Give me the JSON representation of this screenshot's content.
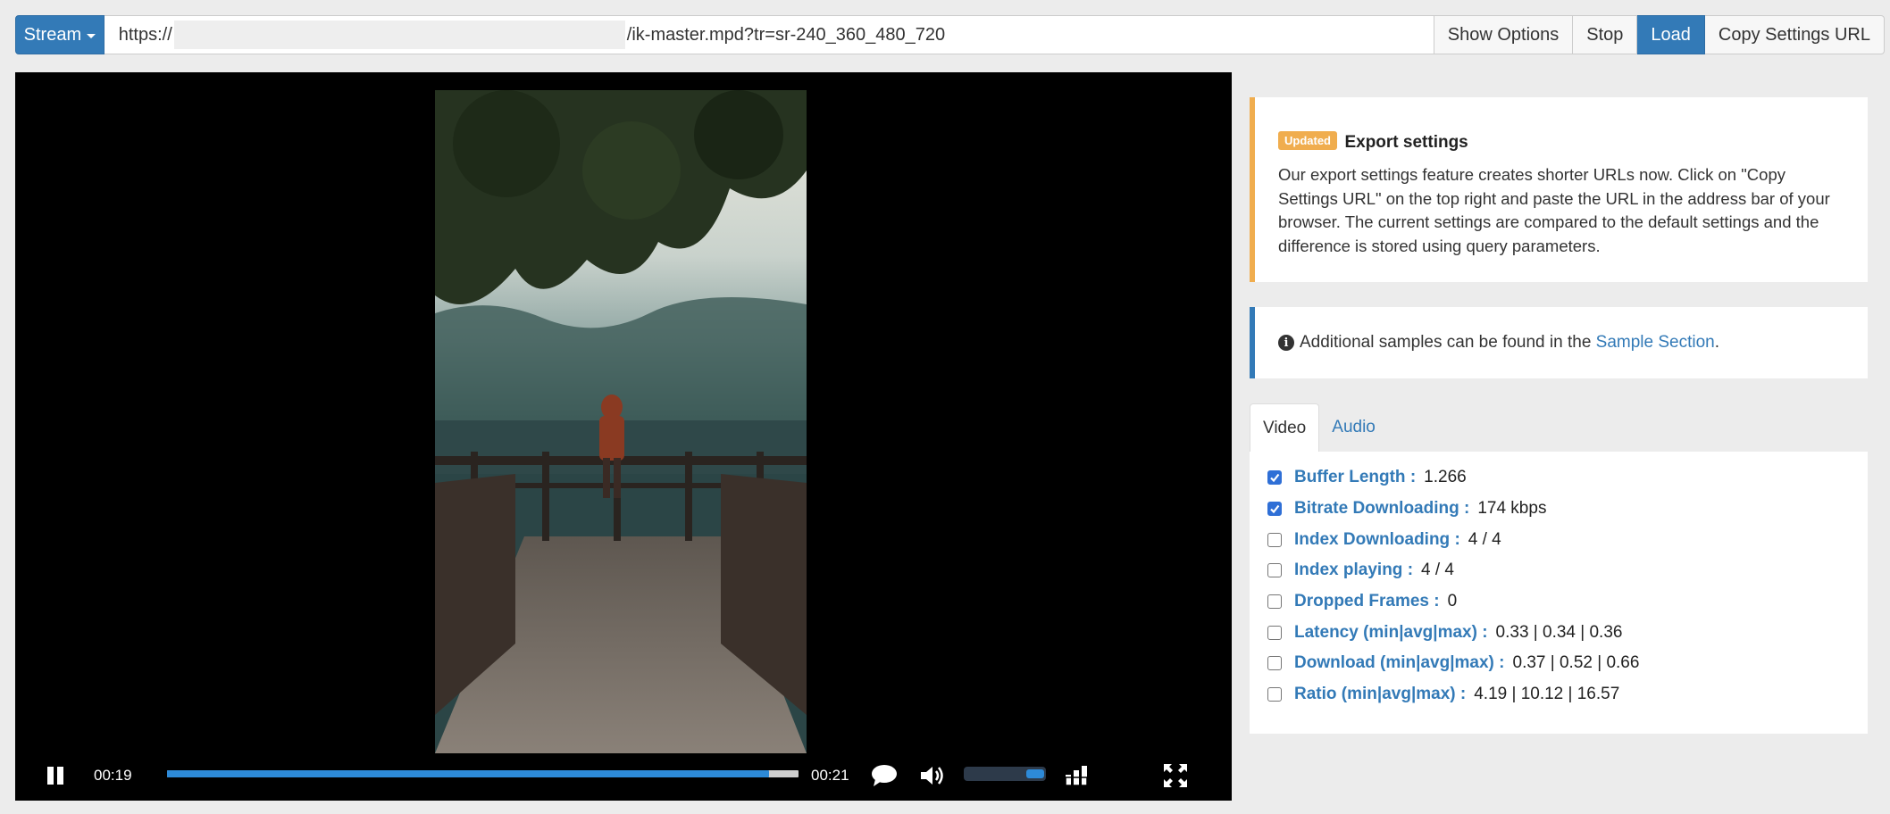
{
  "topbar": {
    "stream_label": "Stream",
    "url_prefix": "https://",
    "url_suffix": "/ik-master.mpd?tr=sr-240_360_480_720",
    "show_options_label": "Show Options",
    "stop_label": "Stop",
    "load_label": "Load",
    "copy_settings_label": "Copy Settings URL"
  },
  "player": {
    "current_time": "00:19",
    "duration": "00:21",
    "progress_fraction": 0.953,
    "volume_fraction": 0.8,
    "icons": [
      "pause-icon",
      "captions-icon",
      "volume-icon",
      "bitrate-icon",
      "fullscreen-icon"
    ]
  },
  "notice_updated": {
    "badge": "Updated",
    "title": "Export settings",
    "text": "Our export settings feature creates shorter URLs now. Click on \"Copy Settings URL\" on the top right and paste the URL in the address bar of your browser. The current settings are compared to the default settings and the difference is stored using query parameters."
  },
  "notice_samples": {
    "text_before": "Additional samples can be found in the",
    "link_text": "Sample Section",
    "text_after": "."
  },
  "tabs": [
    {
      "label": "Video",
      "active": true
    },
    {
      "label": "Audio",
      "active": false
    }
  ],
  "stats": [
    {
      "label": "Buffer Length :",
      "value": "1.266",
      "checked": true
    },
    {
      "label": "Bitrate Downloading :",
      "value": "174 kbps",
      "checked": true
    },
    {
      "label": "Index Downloading :",
      "value": "4 / 4",
      "checked": false
    },
    {
      "label": "Index playing :",
      "value": "4 / 4",
      "checked": false
    },
    {
      "label": "Dropped Frames :",
      "value": "0",
      "checked": false
    },
    {
      "label": "Latency (min|avg|max) :",
      "value": "0.33 | 0.34 | 0.36",
      "checked": false
    },
    {
      "label": "Download (min|avg|max) :",
      "value": "0.37 | 0.52 | 0.66",
      "checked": false
    },
    {
      "label": "Ratio (min|avg|max) :",
      "value": "4.19 | 10.12 | 16.57",
      "checked": false
    }
  ],
  "colors": {
    "primary": "#337ab7",
    "warning": "#f0ad4e",
    "progress": "#2d8ad8",
    "checkbox": "#2f6fd6"
  }
}
